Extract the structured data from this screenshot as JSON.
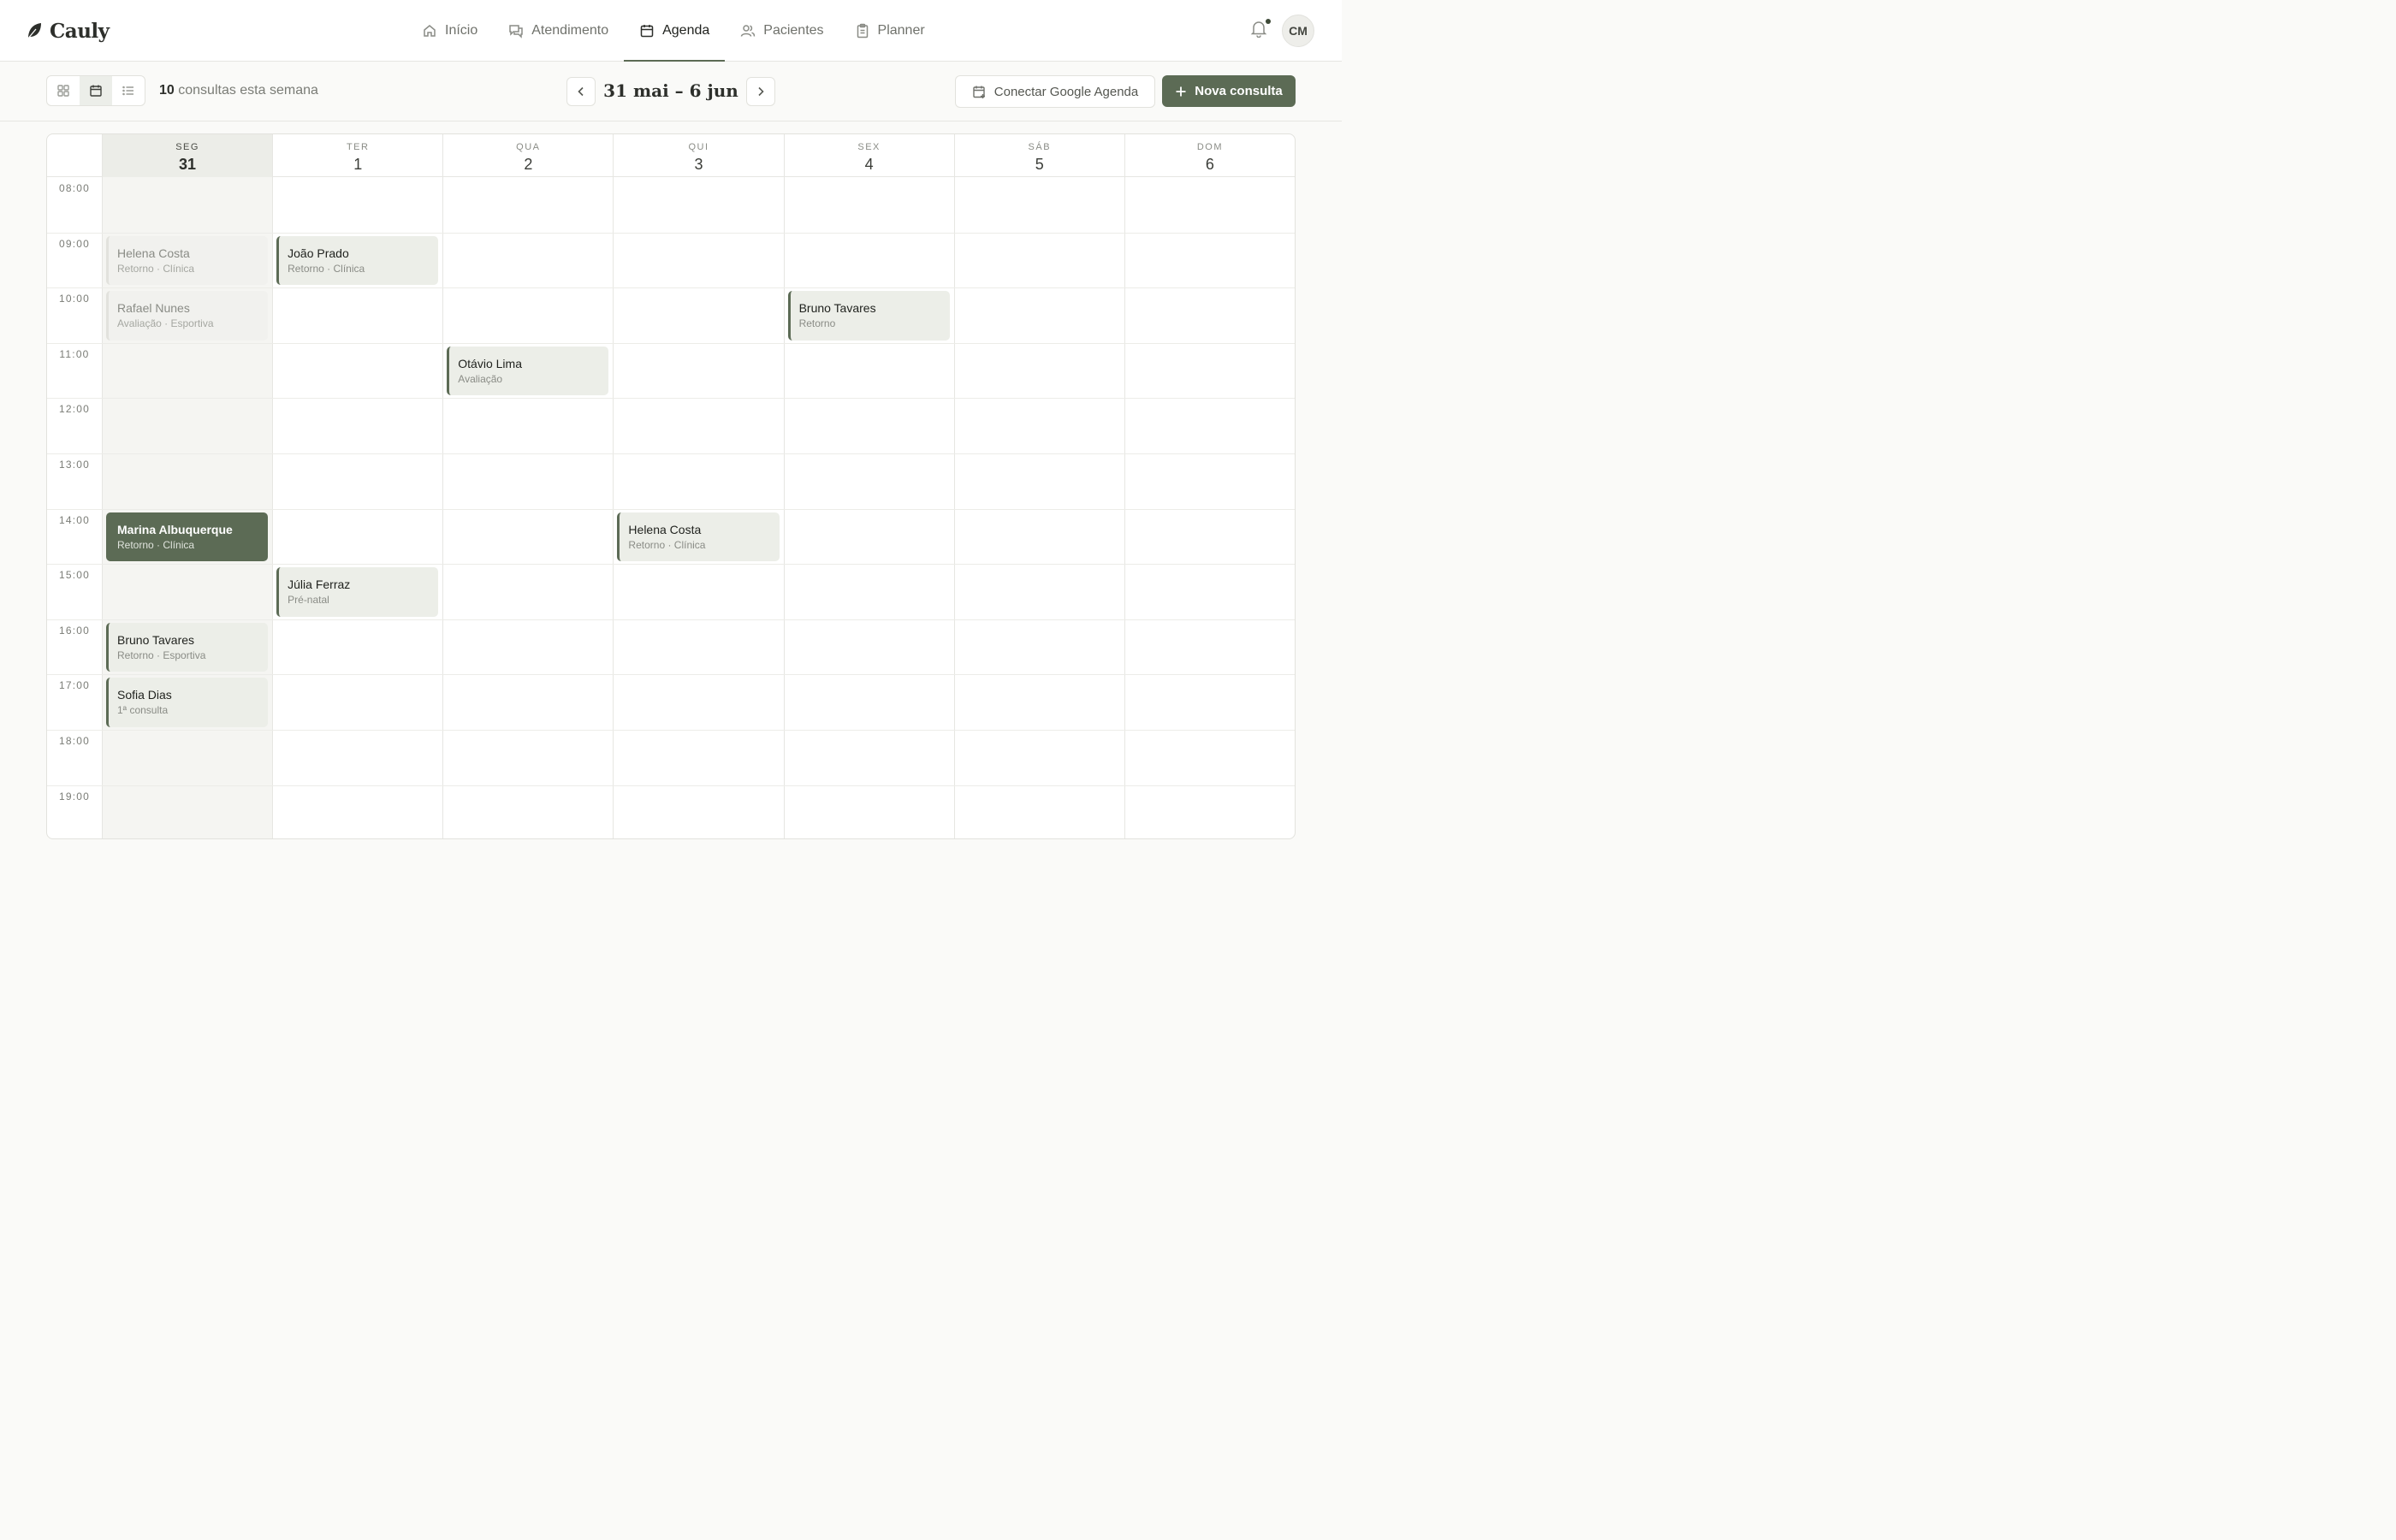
{
  "app": {
    "name": "Cauly",
    "user_initials": "CM"
  },
  "nav": {
    "tabs": [
      {
        "label": "Início",
        "icon": "home-icon"
      },
      {
        "label": "Atendimento",
        "icon": "chat-icon"
      },
      {
        "label": "Agenda",
        "icon": "calendar-icon",
        "active": true
      },
      {
        "label": "Pacientes",
        "icon": "users-icon"
      },
      {
        "label": "Planner",
        "icon": "clipboard-icon"
      }
    ]
  },
  "toolbar": {
    "week_count": "10",
    "week_count_suffix": " consultas esta semana",
    "range_title": "31 mai – 6 jun",
    "gcal_label": "Conectar Google Agenda",
    "new_label": "Nova consulta"
  },
  "calendar": {
    "days": [
      {
        "abbr": "SEG",
        "num": "31",
        "today": true
      },
      {
        "abbr": "TER",
        "num": "1"
      },
      {
        "abbr": "QUA",
        "num": "2"
      },
      {
        "abbr": "QUI",
        "num": "3"
      },
      {
        "abbr": "SEX",
        "num": "4"
      },
      {
        "abbr": "SÁB",
        "num": "5"
      },
      {
        "abbr": "DOM",
        "num": "6"
      }
    ],
    "hours": [
      "08:00",
      "09:00",
      "10:00",
      "11:00",
      "12:00",
      "13:00",
      "14:00",
      "15:00",
      "16:00",
      "17:00",
      "18:00",
      "19:00"
    ],
    "events": [
      {
        "day": 0,
        "hour": 1,
        "name": "Helena Costa",
        "sub": "Retorno · Clínica",
        "state": "past"
      },
      {
        "day": 0,
        "hour": 2,
        "name": "Rafael Nunes",
        "sub": "Avaliação · Esportiva",
        "state": "past"
      },
      {
        "day": 0,
        "hour": 6,
        "name": "Marina Albuquerque",
        "sub": "Retorno · Clínica",
        "state": "selected"
      },
      {
        "day": 0,
        "hour": 8,
        "name": "Bruno Tavares",
        "sub": "Retorno · Esportiva",
        "state": "normal"
      },
      {
        "day": 0,
        "hour": 9,
        "name": "Sofia Dias",
        "sub": "1ª consulta",
        "state": "normal"
      },
      {
        "day": 1,
        "hour": 1,
        "name": "João Prado",
        "sub": "Retorno · Clínica",
        "state": "normal"
      },
      {
        "day": 1,
        "hour": 7,
        "name": "Júlia Ferraz",
        "sub": "Pré-natal",
        "state": "normal"
      },
      {
        "day": 2,
        "hour": 3,
        "name": "Otávio Lima",
        "sub": "Avaliação",
        "state": "normal"
      },
      {
        "day": 3,
        "hour": 6,
        "name": "Helena Costa",
        "sub": "Retorno · Clínica",
        "state": "normal"
      },
      {
        "day": 4,
        "hour": 2,
        "name": "Bruno Tavares",
        "sub": "Retorno",
        "state": "normal"
      }
    ]
  }
}
